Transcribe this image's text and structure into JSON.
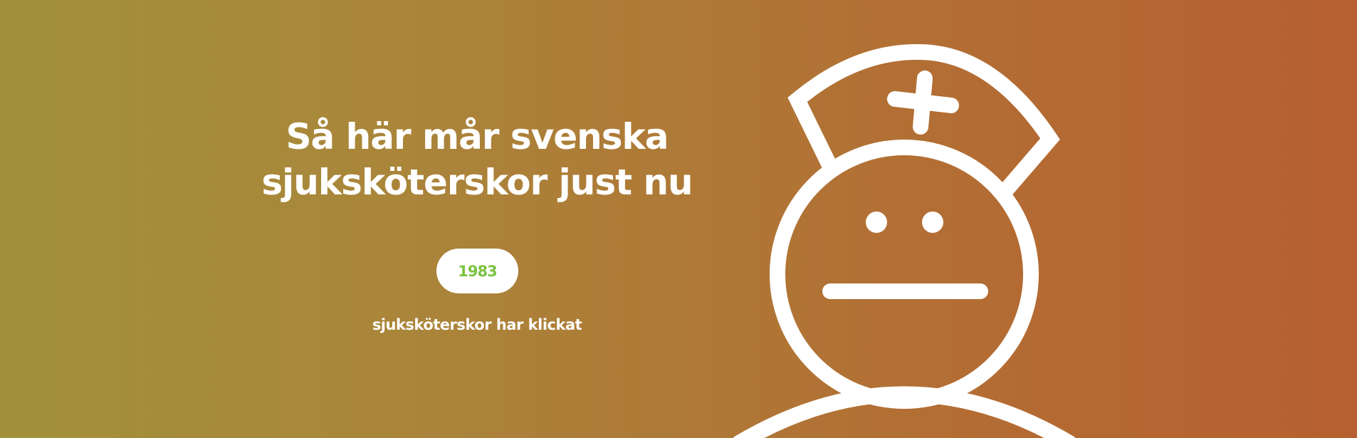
{
  "hero": {
    "headline_line1": "Så här mår svenska",
    "headline_line2": "sjuksköterskor just nu",
    "counter_value": "1983",
    "counter_caption": "sjuksköterskor har klickat"
  },
  "colors": {
    "gradient_start": "#a2913a",
    "gradient_end": "#b75f30",
    "counter_text": "#7cc242",
    "foreground": "#ffffff"
  },
  "icons": {
    "illustration": "nurse-neutral-face-icon",
    "cap_symbol": "cross-icon"
  }
}
